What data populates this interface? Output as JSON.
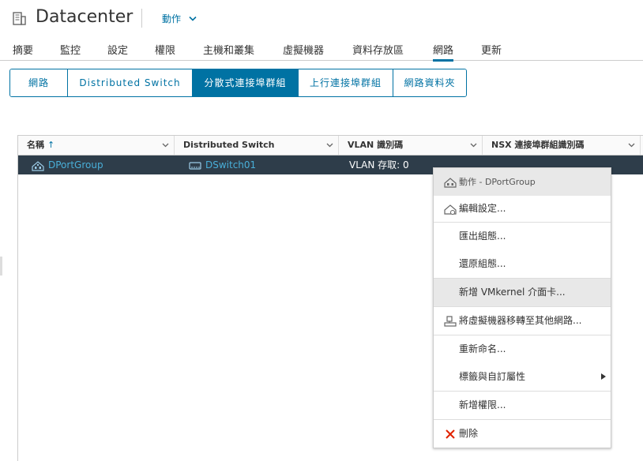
{
  "header": {
    "title": "Datacenter",
    "actions_label": "動作"
  },
  "tabs": [
    {
      "label": "摘要"
    },
    {
      "label": "監控"
    },
    {
      "label": "設定"
    },
    {
      "label": "權限"
    },
    {
      "label": "主機和叢集"
    },
    {
      "label": "虛擬機器"
    },
    {
      "label": "資料存放區"
    },
    {
      "label": "網路",
      "active": true
    },
    {
      "label": "更新"
    }
  ],
  "subtabs": [
    {
      "label": "網路"
    },
    {
      "label": "Distributed Switch"
    },
    {
      "label": "分散式連接埠群組",
      "active": true
    },
    {
      "label": "上行連接埠群組"
    },
    {
      "label": "網路資料夾"
    }
  ],
  "grid": {
    "columns": [
      {
        "label": "名稱"
      },
      {
        "label": "Distributed Switch"
      },
      {
        "label": "VLAN 識別碼"
      },
      {
        "label": "NSX 連接埠群組識別碼"
      }
    ],
    "rows": [
      {
        "name": "DPortGroup",
        "switch": "DSwitch01",
        "vlan": "VLAN 存取: 0"
      }
    ]
  },
  "context_menu": {
    "header": "動作 - DPortGroup",
    "items": [
      {
        "label": "編輯設定..."
      },
      {
        "label": "匯出組態..."
      },
      {
        "label": "還原組態..."
      },
      {
        "label": "新增 VMkernel 介面卡..."
      },
      {
        "label": "將虛擬機器移轉至其他網路..."
      },
      {
        "label": "重新命名..."
      },
      {
        "label": "標籤與自訂屬性"
      },
      {
        "label": "新增權限..."
      },
      {
        "label": "刪除"
      }
    ]
  },
  "colors": {
    "accent": "#0072a3",
    "selected_row": "#2e3d4a",
    "link": "#49afd9",
    "delete": "#e12200"
  }
}
